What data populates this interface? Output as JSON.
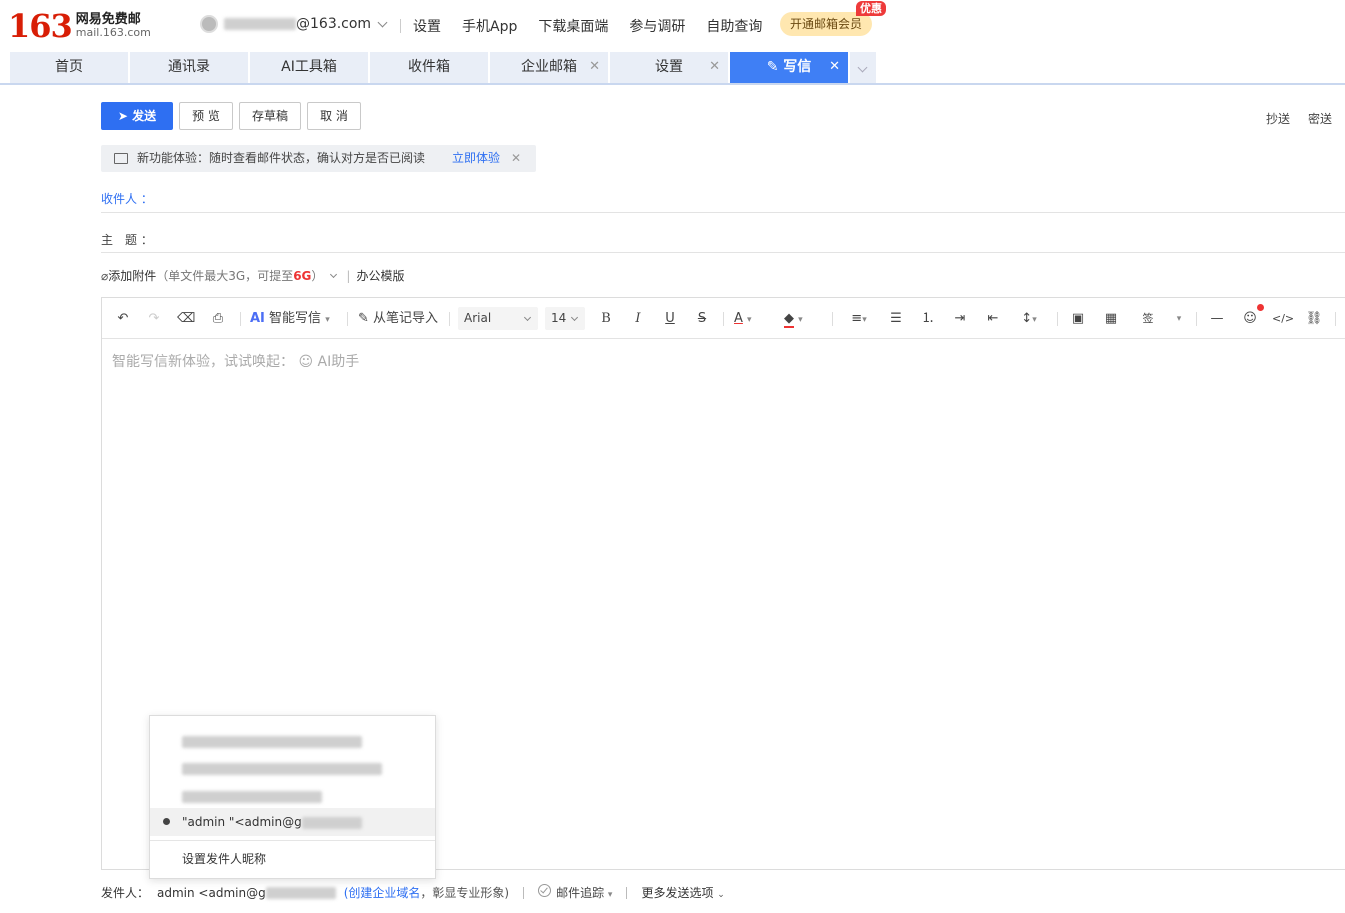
{
  "brand": {
    "logo_number": "163",
    "logo_cn": "网易免费邮",
    "logo_domain": "mail.163.com"
  },
  "account": {
    "email_suffix": "@163.com"
  },
  "topnav": {
    "settings": "设置",
    "mobile_app": "手机App",
    "desktop": "下载桌面端",
    "survey": "参与调研",
    "self_help": "自助查询",
    "vip": "开通邮箱会员",
    "vip_badge": "优惠"
  },
  "tabs": [
    {
      "label": "首页"
    },
    {
      "label": "通讯录"
    },
    {
      "label": "AI工具箱"
    },
    {
      "label": "收件箱"
    },
    {
      "label": "企业邮箱"
    },
    {
      "label": "设置"
    },
    {
      "label": "写信"
    }
  ],
  "actions": {
    "send": "发送",
    "preview": "预 览",
    "draft": "存草稿",
    "cancel": "取 消",
    "cc": "抄送",
    "bcc": "密送"
  },
  "notice": {
    "text": "新功能体验：随时查看邮件状态，确认对方是否已阅读",
    "try": "立即体验"
  },
  "fields": {
    "to_label": "收件人",
    "subject_label": "主　题",
    "colon": "："
  },
  "attach": {
    "label": "添加附件",
    "limit_prefix": "（单文件最大3G，",
    "limit_mid": "可提至",
    "limit_max": "6G",
    "limit_suffix": "）",
    "template": "办公模版"
  },
  "toolbar": {
    "ai_mark": "AI",
    "ai_write": "智能写信",
    "from_notes": "从笔记导入",
    "font": "Arial",
    "size": "14",
    "signature": "签"
  },
  "editor": {
    "placeholder": "智能写信新体验，试试唤起：",
    "ai_helper": "AI助手"
  },
  "sender_menu": {
    "selected": "\"admin \"<admin@g",
    "set_nickname": "设置发件人昵称"
  },
  "footer": {
    "sender_label": "发件人：",
    "sender_value": "admin <admin@g",
    "create_domain": "(创建企业域名",
    "create_domain_tail": "，彰显专业形象)",
    "tracking": "邮件追踪",
    "more_options": "更多发送选项"
  },
  "colors": {
    "accent": "#2e6ff2",
    "brand_red": "#d81e06",
    "tab_bg": "#e9eef7"
  }
}
